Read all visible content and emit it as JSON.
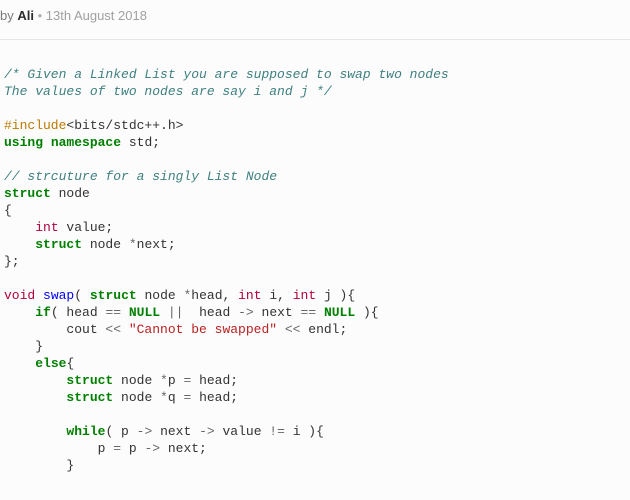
{
  "byline": {
    "by": "by ",
    "author": "Ali",
    "dot": " • ",
    "date": "13th August 2018"
  },
  "code": {
    "line1": "/* Given a Linked List you are supposed to swap two nodes",
    "line2": "The values of two nodes are say i and j */",
    "include_hash": "#include",
    "include_rest": "<bits/stdc++.h>",
    "kw_using": "using",
    "kw_namespace": "namespace",
    "ns_std": " std;",
    "comment_struct": "// strcuture for a singly List Node",
    "kw_struct": "struct",
    "struct_name": " node",
    "brace_open": "{",
    "kw_int": "int",
    "value_decl": " value;",
    "next_decl": " node ",
    "star": "*",
    "next_name": "next;",
    "brace_close": "};",
    "kw_void": "void",
    "fn_swap": "swap",
    "lparen": "( ",
    "head_decl": " node ",
    "head_name": "head, ",
    "i_name": " i, ",
    "j_name": " j ){",
    "kw_if": "if",
    "if_open": "( head ",
    "op_eq": "==",
    "null": "NULL",
    "op_or": " || ",
    "head2": " head ",
    "arrow": "->",
    "next_eq": " next ",
    "if_close": " ){",
    "cout": "        cout ",
    "op_lt": "<<",
    "str_swap": " \"Cannot be swapped\" ",
    "endl": " endl;",
    "rbrace": "    }",
    "kw_else": "else",
    "else_brace": "{",
    "p_decl": " node ",
    "p_name": "p ",
    "op_assign": "=",
    "head_semi": " head;",
    "q_name": "q ",
    "kw_while": "while",
    "while_open": "( p ",
    "next_sp": " next ",
    "value_sp": " value ",
    "op_neq": "!=",
    "i_close": " i ){",
    "p_assign": "            p ",
    "p_rhs": " p ",
    "next_semi": " next;",
    "rbrace2": "        }"
  }
}
